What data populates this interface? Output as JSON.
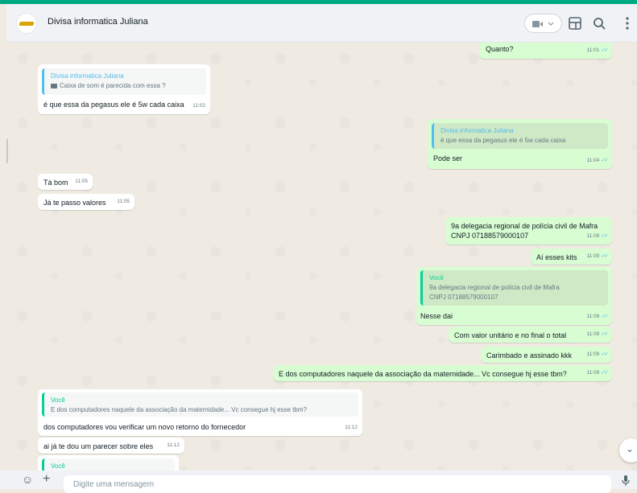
{
  "header": {
    "contact_name": "Divisa informatica Juliana",
    "icons": [
      "video-call-icon",
      "chevron-down-icon",
      "catalog-icon",
      "search-icon",
      "menu-icon"
    ]
  },
  "colors": {
    "accent": "#00a884",
    "outgoing_bubble": "#d9fdd3",
    "incoming_bubble": "#ffffff",
    "read_ticks": "#53bdeb"
  },
  "messages": [
    {
      "dir": "out",
      "text": "Quanto?",
      "time": "11:01"
    },
    {
      "dir": "in",
      "quote_author": "Divisa informatica Juliana",
      "quote_text": "Caixa de som é parecida com essa ?",
      "text": "é que essa da pegasus ele é 5w cada caixa",
      "time": "11:02"
    },
    {
      "dir": "out",
      "quote_author": "Divisa informatica Juliana",
      "quote_text": "é que essa da pegasus ele é 5w cada caixa",
      "text": "Pode ser",
      "time": "11:04"
    },
    {
      "dir": "in",
      "text": "Tá bom",
      "time": "11:05"
    },
    {
      "dir": "in",
      "text": "Já te passo valores",
      "time": "11:05"
    },
    {
      "dir": "out",
      "text": "9a delegacia regional de polícia civil de Mafra",
      "text2": "CNPJ 07188579000107",
      "time": "11:08"
    },
    {
      "dir": "out",
      "text": "Aí esses kits",
      "time": "11:09"
    },
    {
      "dir": "out",
      "quote_author": "Você",
      "quote_text": "9a delegacia regional de polícia civil de Mafra",
      "quote_text2": "CNPJ 07188579000107",
      "text": "Nesse dai",
      "time": "11:09"
    },
    {
      "dir": "out",
      "text": "Com valor unitário e no final o total",
      "time": "11:09"
    },
    {
      "dir": "out",
      "text": "Carimbado e assinado kkk",
      "time": "11:09"
    },
    {
      "dir": "out",
      "text": "E dos computadores naquele da associação da maternidade... Vc consegue hj esse tbm?",
      "time": "11:09"
    },
    {
      "dir": "in",
      "quote_author": "Você",
      "quote_text": "E dos computadores naquele da associação da maternidade... Vc consegue hj esse tbm?",
      "text": "dos computadores vou verificar um novo retorno do fornecedor",
      "time": "11:12"
    },
    {
      "dir": "in",
      "text": "ai já te dou um parecer sobre eles",
      "time": "11:12"
    },
    {
      "dir": "in",
      "quote_author": "Você"
    }
  ],
  "composer": {
    "placeholder": "Digite uma mensagem",
    "icons": [
      "emoji-icon",
      "plus-icon",
      "mic-icon"
    ]
  }
}
